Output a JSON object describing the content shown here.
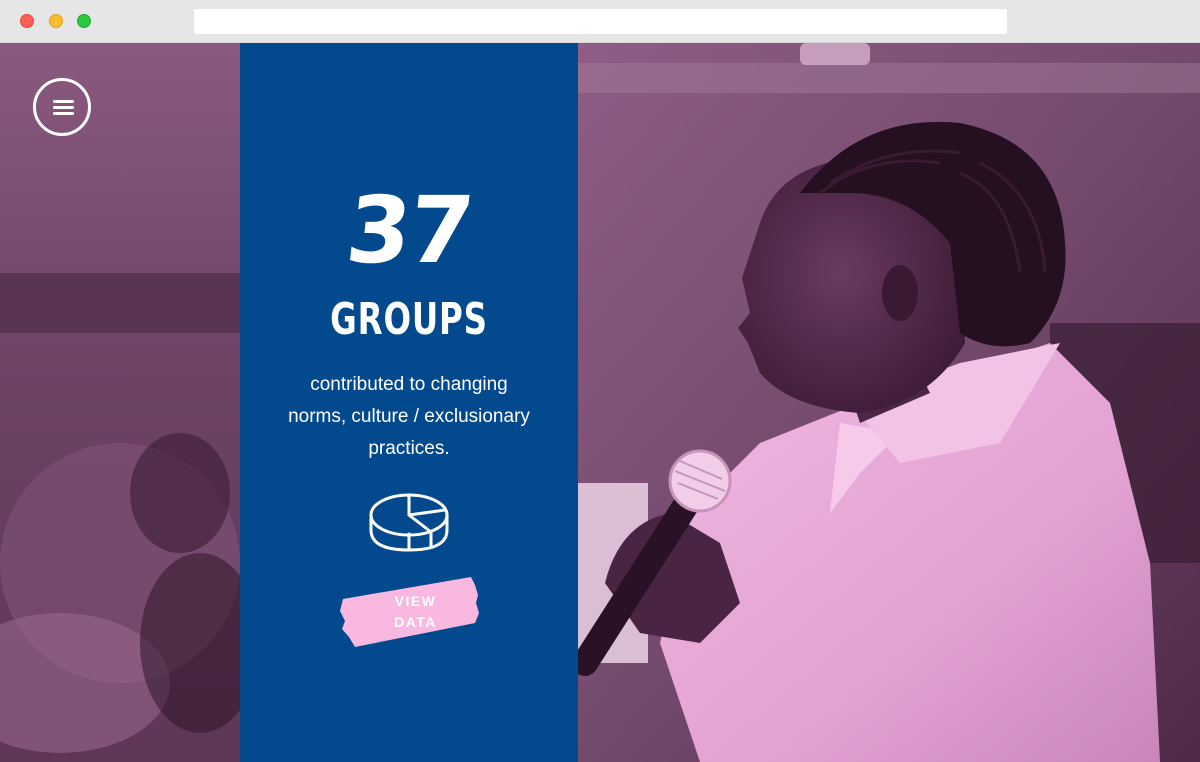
{
  "window": {
    "address": ""
  },
  "menu": {
    "icon": "hamburger-menu-icon"
  },
  "stat": {
    "number": "37",
    "unit": "GROUPS",
    "description": "contributed to changing norms, culture / exclusionary practices."
  },
  "data_button": {
    "icon": "pie-chart-icon",
    "label": "VIEW DATA"
  },
  "colors": {
    "panel_blue": "#03498d",
    "button_pink": "#f9b8e0",
    "photo_tint": "#c77fb3"
  }
}
